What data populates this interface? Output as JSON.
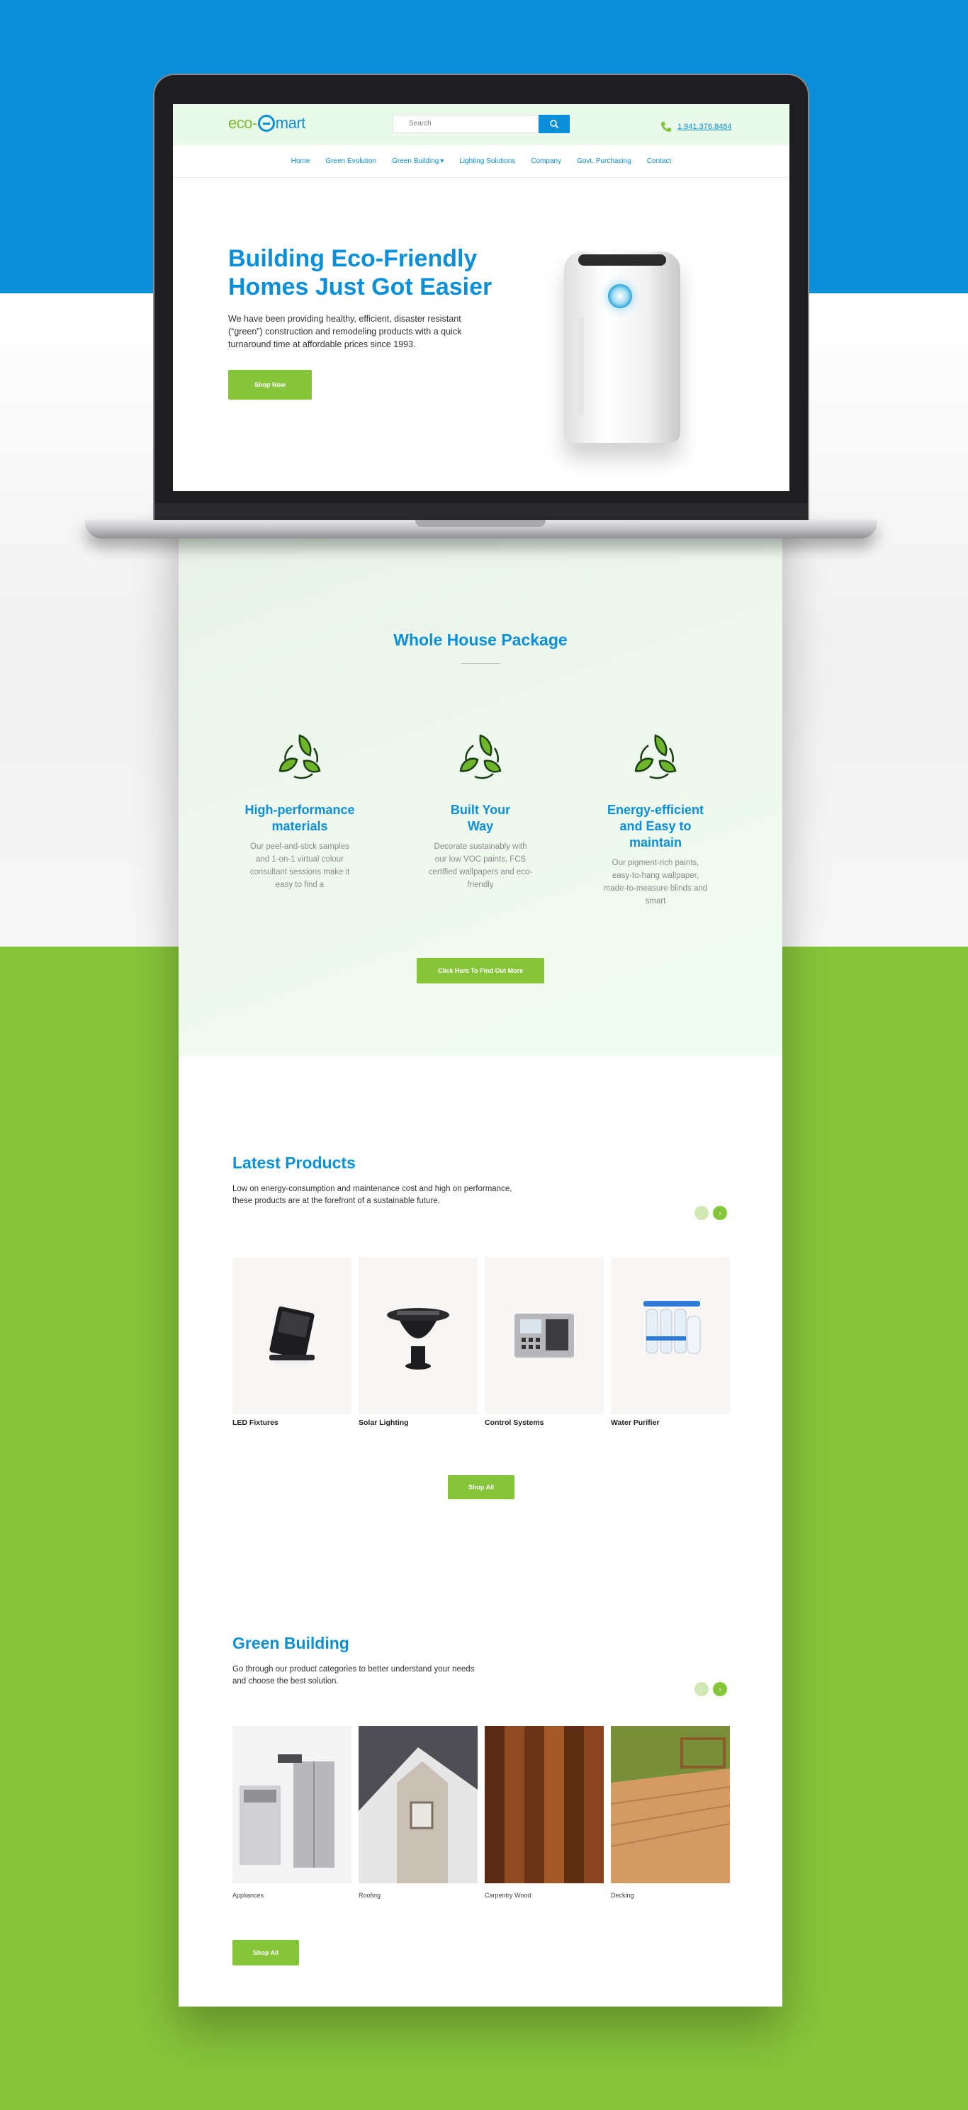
{
  "header": {
    "logo_left": "eco-",
    "logo_right": "mart",
    "search_placeholder": "Search",
    "phone": "1.941.376.8484"
  },
  "nav": {
    "items": [
      "Home",
      "Green Evolution",
      "Green Building",
      "Lighting Solutions",
      "Company",
      "Govt. Purchasing",
      "Contact"
    ]
  },
  "hero": {
    "title": "Building Eco-Friendly Homes Just Got Easier",
    "text": "We have been providing healthy, efficient, disaster resistant (“green”) construction and remodeling products with a quick turnaround time at affordable prices since 1993.",
    "button": "Shop Now"
  },
  "package": {
    "title": "Whole House Package",
    "features": [
      {
        "title": "High-performance materials",
        "text": "Our peel-and-stick samples and 1-on-1 virtual colour consultant sessions make it easy to find a",
        "icon": "recycle-leaf-icon"
      },
      {
        "title": "Built Your Way",
        "text": "Decorate sustainably with our low VOC paints, FCS certified wallpapers and eco-friendly",
        "icon": "recycle-leaf-icon"
      },
      {
        "title": "Energy-efficient and Easy to maintain",
        "text": "Our pigment-rich paints, easy-to-hang wallpaper, made-to-measure blinds and smart",
        "icon": "recycle-leaf-icon"
      }
    ],
    "button": "Click Here To Find Out More"
  },
  "latest": {
    "title": "Latest Products",
    "text": "Low on energy-consumption and maintenance cost and high on performance, these products are at the forefront of a sustainable future.",
    "products": [
      "LED Fixtures",
      "Solar Lighting",
      "Control Systems",
      "Water Purifier"
    ],
    "button": "Shop All"
  },
  "green_building": {
    "title": "Green Building",
    "text": "Go through our product categories to better understand your needs and choose the best solution.",
    "categories": [
      "Appliances",
      "Roofing",
      "Carpentry Wood",
      "Decking"
    ],
    "button": "Shop All"
  },
  "colors": {
    "brand_blue": "#0a8fd8",
    "brand_green": "#86c43a",
    "mint_bg": "#e9f9ea"
  }
}
